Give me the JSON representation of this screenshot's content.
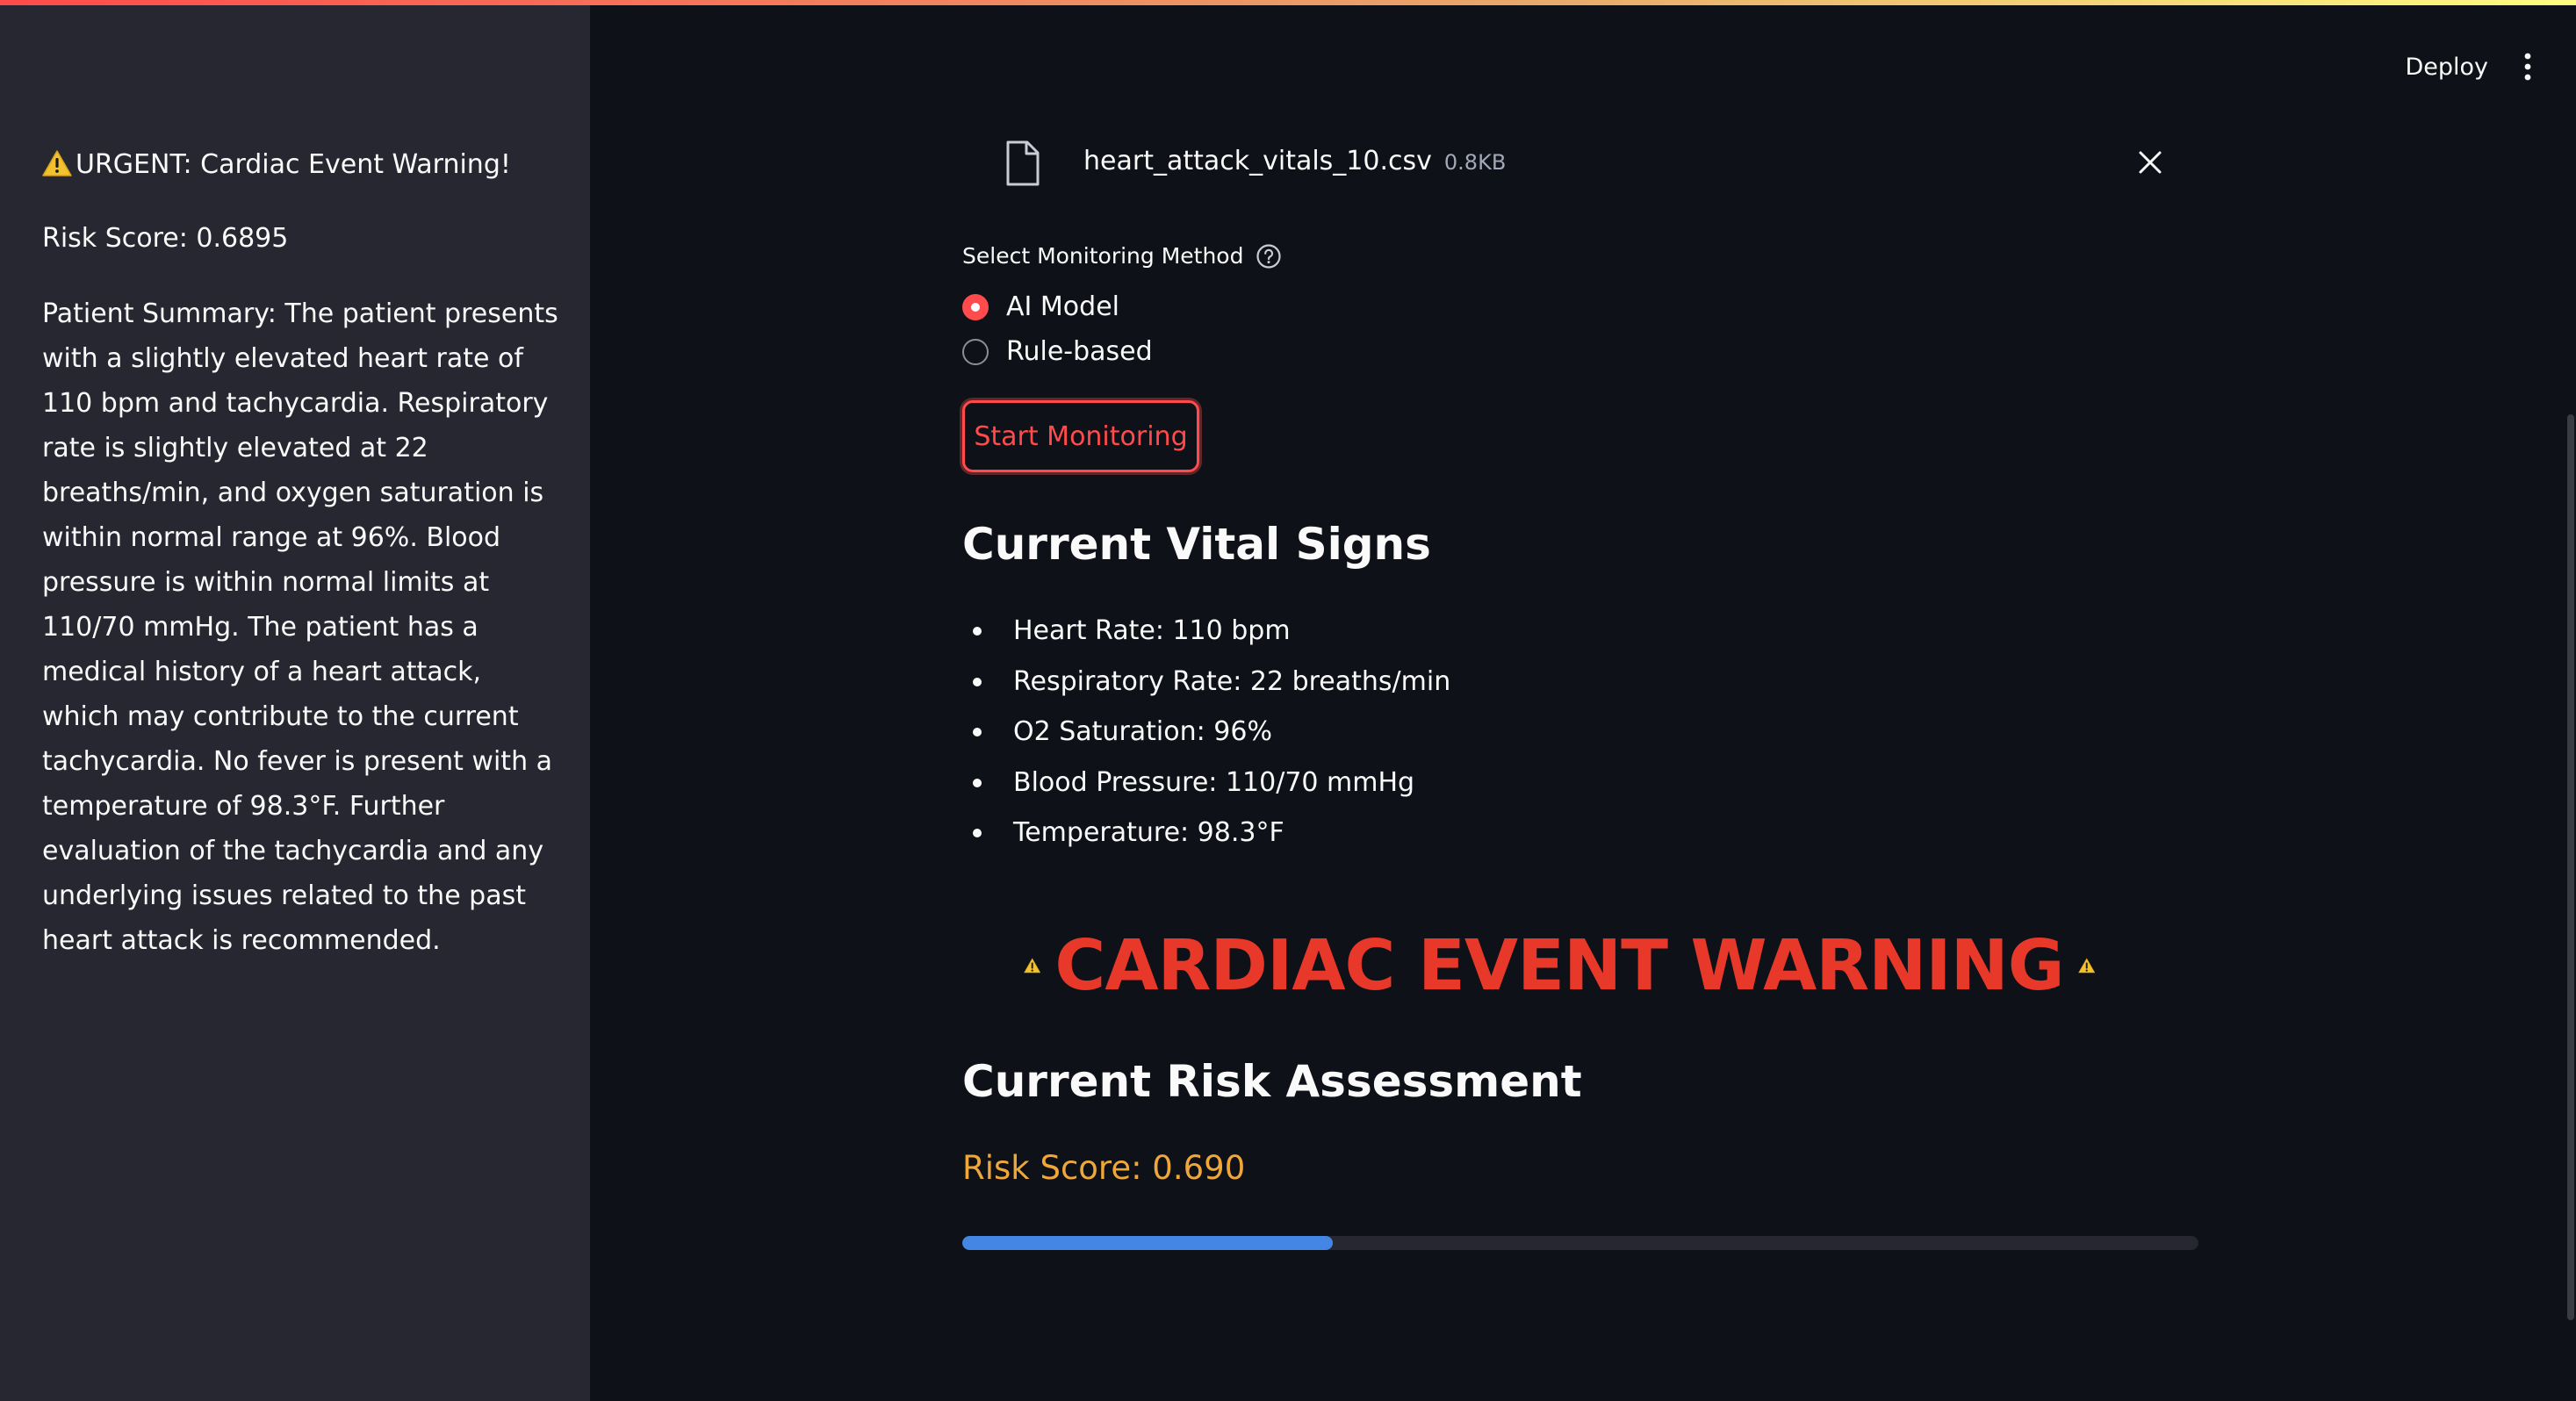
{
  "header": {
    "deploy_label": "Deploy",
    "menu_icon": "kebab-menu-icon"
  },
  "sidebar": {
    "warning_icon": "warning-emoji-icon",
    "warning_text": "URGENT: Cardiac Event Warning!",
    "risk_score_text": "Risk Score: 0.6895",
    "summary_text": "Patient Summary: The patient presents with a slightly elevated heart rate of 110 bpm and tachycardia. Respiratory rate is slightly elevated at 22 breaths/min, and oxygen saturation is within normal range at 96%. Blood pressure is within normal limits at 110/70 mmHg. The patient has a medical history of a heart attack, which may contribute to the current tachycardia. No fever is present with a temperature of 98.3°F. Further evaluation of the tachycardia and any underlying issues related to the past heart attack is recommended."
  },
  "file_upload": {
    "file_name": "heart_attack_vitals_10.csv",
    "file_size": "0.8KB",
    "file_icon": "file-icon",
    "remove_icon": "close-icon"
  },
  "monitoring": {
    "label": "Select Monitoring Method",
    "help_icon": "help-circle-icon",
    "options": [
      {
        "label": "AI Model",
        "selected": true
      },
      {
        "label": "Rule-based",
        "selected": false
      }
    ],
    "start_button_label": "Start Monitoring"
  },
  "vitals": {
    "heading": "Current Vital Signs",
    "items": [
      "Heart Rate: 110 bpm",
      "Respiratory Rate: 22 breaths/min",
      "O2 Saturation: 96%",
      "Blood Pressure: 110/70 mmHg",
      "Temperature: 98.3°F"
    ]
  },
  "warning_banner": {
    "text": "CARDIAC EVENT WARNING",
    "icon": "warning-emoji-icon",
    "color": "#e8382a"
  },
  "risk": {
    "heading": "Current Risk Assessment",
    "score_text": "Risk Score: 0.690",
    "score_color": "#f0a73a",
    "progress_fraction": 0.3,
    "progress_color": "#4486e4"
  },
  "colors": {
    "background": "#0e1117",
    "sidebar": "#262730",
    "accent": "#ff4b4b"
  }
}
